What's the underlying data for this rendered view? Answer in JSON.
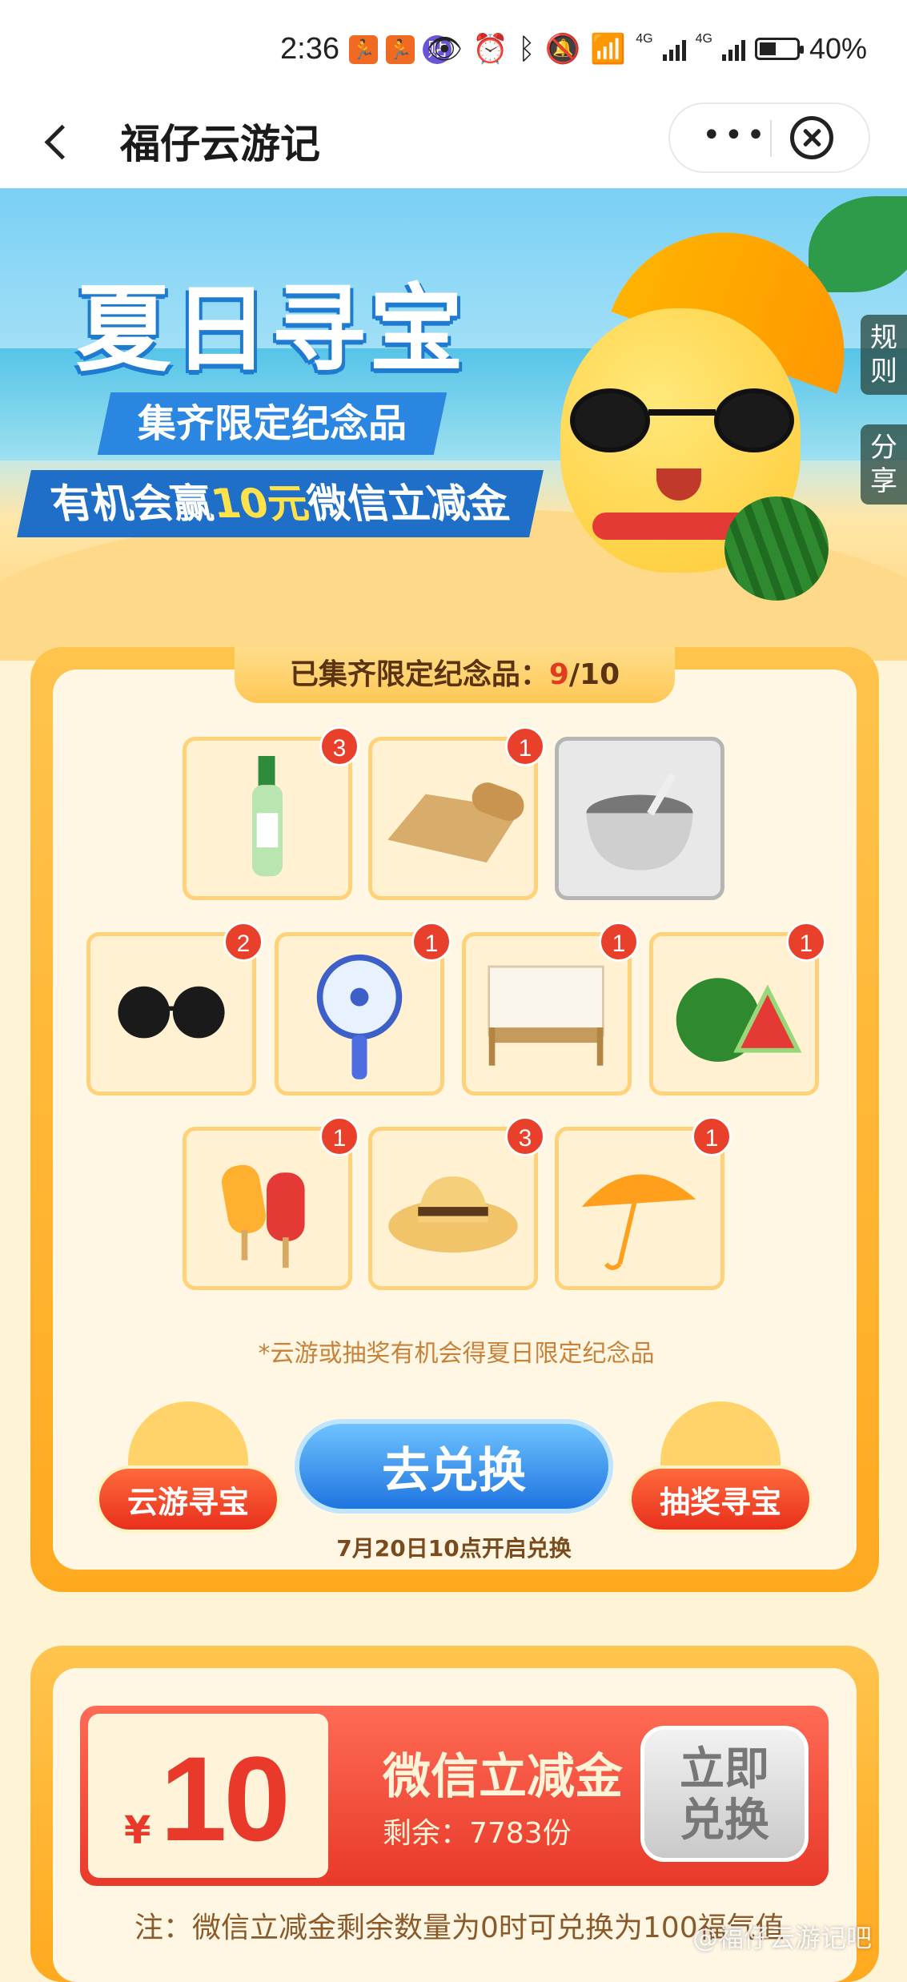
{
  "status_bar": {
    "time": "2:36",
    "app_icons": [
      "🏃",
      "🏃",
      "贴"
    ],
    "network_label_1": "4G",
    "network_label_2": "4G",
    "battery": "40%"
  },
  "nav": {
    "title": "福仔云游记",
    "more_label": "•••"
  },
  "banner": {
    "title": "夏日寻宝",
    "subtitle1": "集齐限定纪念品",
    "subtitle2_prefix": "有机会赢",
    "subtitle2_highlight": "10元",
    "subtitle2_suffix": "微信立减金",
    "rules_tab": "规则",
    "share_tab": "分享"
  },
  "collection": {
    "progress_label": "已集齐限定纪念品：",
    "progress_current": "9",
    "progress_total": "/10",
    "items": [
      {
        "name": "花露水",
        "icon": "perfume-bottle-icon",
        "count": "3",
        "collected": true
      },
      {
        "name": "凉席",
        "icon": "bamboo-mat-icon",
        "count": "1",
        "collected": true
      },
      {
        "name": "绿豆汤",
        "icon": "bean-soup-bowl-icon",
        "count": "",
        "collected": false
      },
      {
        "name": "墨镜",
        "icon": "sunglasses-icon",
        "count": "2",
        "collected": true
      },
      {
        "name": "小风扇",
        "icon": "handheld-fan-icon",
        "count": "1",
        "collected": true
      },
      {
        "name": "蚊帐床",
        "icon": "mosquito-net-bed-icon",
        "count": "1",
        "collected": true
      },
      {
        "name": "西瓜",
        "icon": "watermelon-icon",
        "count": "1",
        "collected": true
      },
      {
        "name": "冰棍",
        "icon": "popsicle-icon",
        "count": "1",
        "collected": true
      },
      {
        "name": "草帽",
        "icon": "straw-hat-icon",
        "count": "3",
        "collected": true
      },
      {
        "name": "雨伞",
        "icon": "umbrella-icon",
        "count": "1",
        "collected": true
      }
    ],
    "hint": "*云游或抽奖有机会得夏日限定纪念品",
    "cloud_button": "云游寻宝",
    "exchange_button": "去兑换",
    "lottery_button": "抽奖寻宝",
    "open_time": "7月20日10点开启兑换"
  },
  "coupon": {
    "currency": "¥",
    "amount": "10",
    "name": "微信立减金",
    "remaining": "剩余：7783份",
    "button": "立即兑换",
    "note": "注：微信立减金剩余数量为0时可兑换为100福气值"
  },
  "watermark": "@福仔云游记吧",
  "colors": {
    "accent_orange": "#ffa91f",
    "badge_red": "#e8402a",
    "exchange_blue": "#1f74e0"
  }
}
